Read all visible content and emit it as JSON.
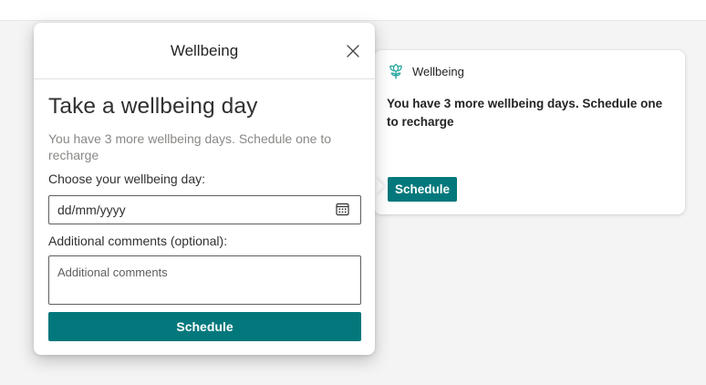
{
  "card": {
    "title": "Wellbeing",
    "icon": "flower-icon",
    "message": "You have 3 more wellbeing days. Schedule one to recharge",
    "button_label": "Schedule"
  },
  "dialog": {
    "title": "Wellbeing",
    "close_icon": "close-icon",
    "heading": "Take a wellbeing day",
    "subtext": "You have 3 more wellbeing days. Schedule one to recharge",
    "date_label": "Choose your wellbeing day:",
    "date_placeholder": "dd/mm/yyyy",
    "calendar_icon": "calendar-icon",
    "comments_label": "Additional comments (optional):",
    "comments_placeholder": "Additional comments",
    "submit_label": "Schedule"
  },
  "colors": {
    "accent": "#03787c",
    "flower_icon": "#2aa8a0",
    "background": "#f4f4f4"
  }
}
